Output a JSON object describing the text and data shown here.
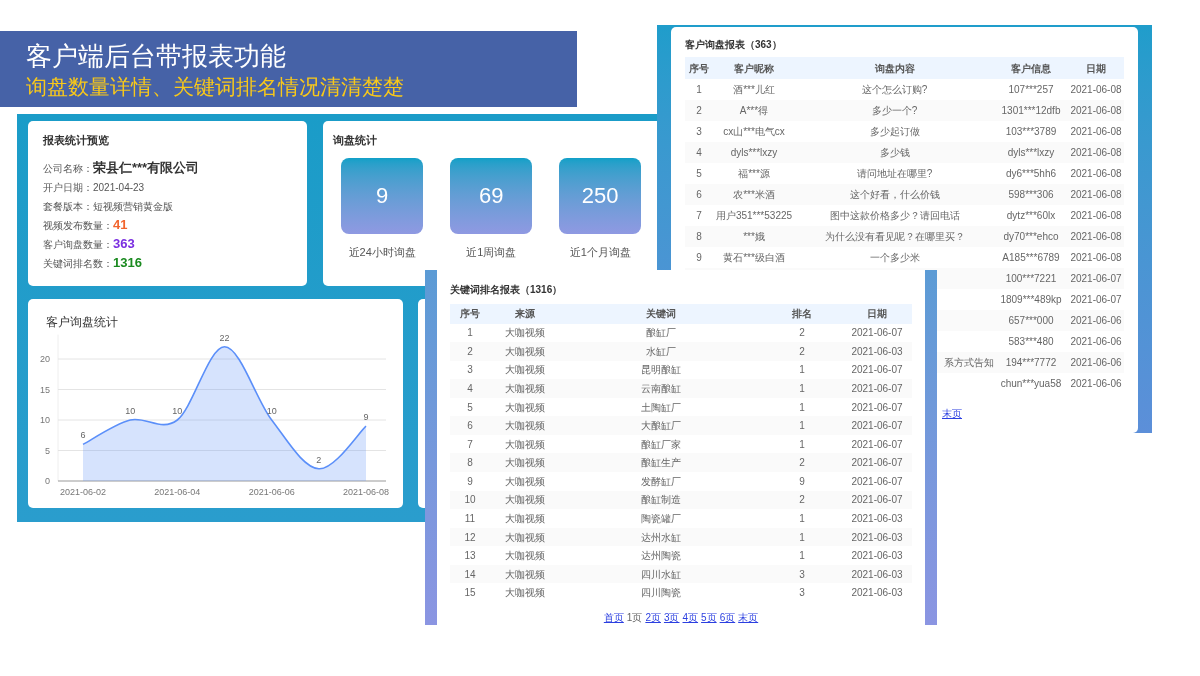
{
  "banner": {
    "title": "客户端后台带报表功能",
    "subtitle": "询盘数量详情、关键词排名情况清清楚楚"
  },
  "overview": {
    "title": "报表统计预览",
    "fields": [
      {
        "label": "公司名称：",
        "value": "荣县仁***有限公司",
        "kind": "name"
      },
      {
        "label": "开户日期：",
        "value": "2021-04-23",
        "kind": "plain"
      },
      {
        "label": "套餐版本：",
        "value": "短视频营销黄金版",
        "kind": "plain"
      },
      {
        "label": "视频发布数量：",
        "value": "41",
        "kind": "count",
        "color": "#f2652e"
      },
      {
        "label": "客户询盘数量：",
        "value": "363",
        "kind": "count",
        "color": "#7a2ee0"
      },
      {
        "label": "关键词排名数：",
        "value": "1316",
        "kind": "count",
        "color": "#1a8a1f"
      }
    ]
  },
  "inquiry_stats": {
    "title": "询盘统计",
    "tiles": [
      {
        "value": "9",
        "caption": "近24小时询盘"
      },
      {
        "value": "69",
        "caption": "近1周询盘"
      },
      {
        "value": "250",
        "caption": "近1个月询盘"
      }
    ]
  },
  "chart_card": {
    "title": "客户询盘统计",
    "chart_data": {
      "type": "area",
      "categories": [
        "2021-06-02",
        null,
        "2021-06-04",
        null,
        "2021-06-06",
        null,
        "2021-06-08"
      ],
      "yticks": [
        0,
        5,
        10,
        15,
        20
      ],
      "ylim": [
        0,
        24
      ],
      "grid": true,
      "series": [
        {
          "color": "#5b8ff9",
          "values": [
            6,
            10,
            10,
            22,
            10,
            2,
            9
          ]
        }
      ],
      "data_labels": true
    }
  },
  "inquiry_report": {
    "title": "客户询盘报表（363）",
    "columns": [
      "序号",
      "客户昵称",
      "询盘内容",
      "客户信息",
      "日期"
    ],
    "rows": [
      {
        "no": "1",
        "nickname": "酒***儿红",
        "content": "这个怎么订购?",
        "info": "107***257",
        "date": "2021-06-08"
      },
      {
        "no": "2",
        "nickname": "A***得",
        "content": "多少一个?",
        "info": "1301***12dfb",
        "date": "2021-06-08"
      },
      {
        "no": "3",
        "nickname": "cx山***电气cx",
        "content": "多少起订做",
        "info": "103***3789",
        "date": "2021-06-08"
      },
      {
        "no": "4",
        "nickname": "dyls***lxzy",
        "content": "多少钱",
        "info": "dyls***lxzy",
        "date": "2021-06-08"
      },
      {
        "no": "5",
        "nickname": "福***源",
        "content": "请问地址在哪里?",
        "info": "dy6***5hh6",
        "date": "2021-06-08"
      },
      {
        "no": "6",
        "nickname": "农***米酒",
        "content": "这个好看，什么价钱",
        "info": "598***306",
        "date": "2021-06-08"
      },
      {
        "no": "7",
        "nickname": "用户351***53225",
        "content": "图中这款价格多少？请回电话",
        "info": "dytz***60lx",
        "date": "2021-06-08"
      },
      {
        "no": "8",
        "nickname": "***娥",
        "content": "为什么没有看见呢？在哪里买？",
        "info": "dy70***ehco",
        "date": "2021-06-08"
      },
      {
        "no": "9",
        "nickname": "黄石***级白酒",
        "content": "一个多少米",
        "info": "A185***6789",
        "date": "2021-06-08"
      },
      {
        "info": "100***7221",
        "date": "2021-06-07"
      },
      {
        "info": "1809***489kp",
        "date": "2021-06-07"
      },
      {
        "info": "657***000",
        "date": "2021-06-06"
      },
      {
        "info": "583***480",
        "date": "2021-06-06"
      },
      {
        "content": "系方式告知",
        "info": "194***7772",
        "date": "2021-06-06"
      },
      {
        "info": "chun***yua58",
        "date": "2021-06-06"
      }
    ],
    "pagination": [
      {
        "label": "末页",
        "selected": false
      }
    ]
  },
  "keyword_report": {
    "title": "关键词排名报表（1316）",
    "columns": [
      "序号",
      "来源",
      "关键词",
      "排名",
      "日期"
    ],
    "rows": [
      {
        "no": "1",
        "source": "大咖视频",
        "keyword": "酿缸厂",
        "rank": "2",
        "date": "2021-06-07"
      },
      {
        "no": "2",
        "source": "大咖视频",
        "keyword": "水缸厂",
        "rank": "2",
        "date": "2021-06-03"
      },
      {
        "no": "3",
        "source": "大咖视频",
        "keyword": "昆明酿缸",
        "rank": "1",
        "date": "2021-06-07"
      },
      {
        "no": "4",
        "source": "大咖视频",
        "keyword": "云南酿缸",
        "rank": "1",
        "date": "2021-06-07"
      },
      {
        "no": "5",
        "source": "大咖视频",
        "keyword": "土陶缸厂",
        "rank": "1",
        "date": "2021-06-07"
      },
      {
        "no": "6",
        "source": "大咖视频",
        "keyword": "大酿缸厂",
        "rank": "1",
        "date": "2021-06-07"
      },
      {
        "no": "7",
        "source": "大咖视频",
        "keyword": "酿缸厂家",
        "rank": "1",
        "date": "2021-06-07"
      },
      {
        "no": "8",
        "source": "大咖视频",
        "keyword": "酿缸生产",
        "rank": "2",
        "date": "2021-06-07"
      },
      {
        "no": "9",
        "source": "大咖视频",
        "keyword": "发酵缸厂",
        "rank": "9",
        "date": "2021-06-07"
      },
      {
        "no": "10",
        "source": "大咖视频",
        "keyword": "酿缸制造",
        "rank": "2",
        "date": "2021-06-07"
      },
      {
        "no": "11",
        "source": "大咖视频",
        "keyword": "陶瓷罐厂",
        "rank": "1",
        "date": "2021-06-03"
      },
      {
        "no": "12",
        "source": "大咖视频",
        "keyword": "达州水缸",
        "rank": "1",
        "date": "2021-06-03"
      },
      {
        "no": "13",
        "source": "大咖视频",
        "keyword": "达州陶瓷",
        "rank": "1",
        "date": "2021-06-03"
      },
      {
        "no": "14",
        "source": "大咖视频",
        "keyword": "四川水缸",
        "rank": "3",
        "date": "2021-06-03"
      },
      {
        "no": "15",
        "source": "大咖视频",
        "keyword": "四川陶瓷",
        "rank": "3",
        "date": "2021-06-03"
      }
    ],
    "pagination": [
      {
        "label": "首页",
        "selected": false
      },
      {
        "label": "1页",
        "selected": true
      },
      {
        "label": "2页",
        "selected": false
      },
      {
        "label": "3页",
        "selected": false
      },
      {
        "label": "4页",
        "selected": false
      },
      {
        "label": "5页",
        "selected": false
      },
      {
        "label": "6页",
        "selected": false
      },
      {
        "label": "末页",
        "selected": false
      }
    ]
  }
}
